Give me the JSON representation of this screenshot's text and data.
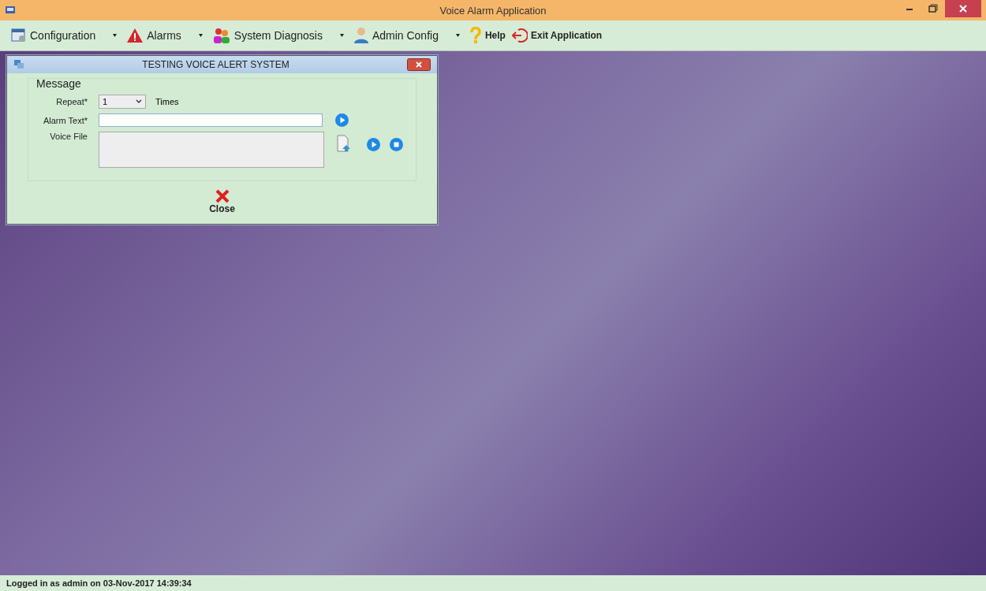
{
  "window": {
    "title": "Voice Alarm Application"
  },
  "menu": [
    {
      "label": "Configuration",
      "bold": false,
      "dropdown": true
    },
    {
      "label": "Alarms",
      "bold": false,
      "dropdown": true
    },
    {
      "label": "System Diagnosis",
      "bold": false,
      "dropdown": true
    },
    {
      "label": "Admin Config",
      "bold": false,
      "dropdown": true
    },
    {
      "label": "Help",
      "bold": true,
      "dropdown": false
    },
    {
      "label": "Exit Application",
      "bold": true,
      "dropdown": false
    }
  ],
  "dialog": {
    "title": "TESTING VOICE ALERT SYSTEM",
    "group": "Message",
    "repeat": {
      "label": "Repeat*",
      "value": "1",
      "unit": "Times"
    },
    "alarm_text": {
      "label": "Alarm Text*"
    },
    "voice_file": {
      "label": "Voice File"
    },
    "close": "Close"
  },
  "status_bar": "Logged in as admin on 03-Nov-2017 14:39:34"
}
